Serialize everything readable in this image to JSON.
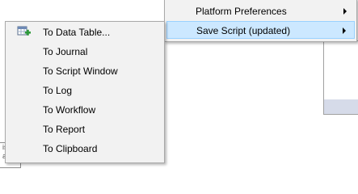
{
  "top_menu": {
    "items": [
      {
        "label": "Platform Preferences",
        "has_submenu": true
      },
      {
        "label": "Save Script (updated)",
        "has_submenu": true
      }
    ]
  },
  "submenu": {
    "items": [
      {
        "label": "To Data Table...",
        "icon": "data-table-add-icon"
      },
      {
        "label": "To Journal"
      },
      {
        "label": "To Script Window"
      },
      {
        "label": "To Log"
      },
      {
        "label": "To Workflow"
      },
      {
        "label": "To Report"
      },
      {
        "label": "To Clipboard"
      }
    ]
  },
  "tooltip_fragment": {
    "line1": "is",
    "line2": "ard"
  },
  "colors": {
    "highlight": "#cce8ff",
    "highlight_border": "#99d1ff",
    "menu_bg": "#f2f2f2"
  }
}
